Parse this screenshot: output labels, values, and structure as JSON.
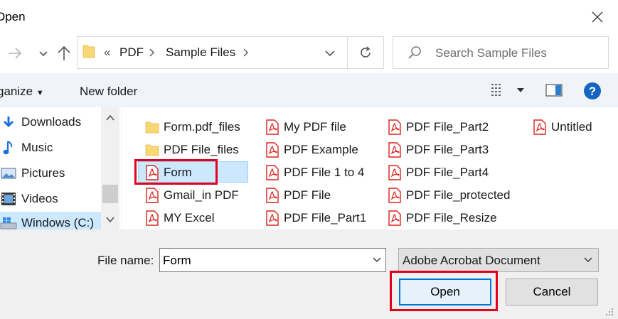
{
  "window": {
    "title": "Open",
    "close_icon": "close-icon"
  },
  "address": {
    "prefix": "«",
    "crumbs": [
      "PDF",
      "Sample Files"
    ],
    "refresh_icon": "refresh-icon"
  },
  "search": {
    "placeholder": "Search Sample Files"
  },
  "commands": {
    "organize": "ganize",
    "new_folder": "New folder"
  },
  "nav": {
    "items": [
      {
        "label": "Downloads",
        "icon": "download-icon"
      },
      {
        "label": "Music",
        "icon": "music-icon"
      },
      {
        "label": "Pictures",
        "icon": "pictures-icon"
      },
      {
        "label": "Videos",
        "icon": "videos-icon"
      },
      {
        "label": "Windows (C:)",
        "icon": "drive-icon"
      }
    ]
  },
  "files": {
    "col1": [
      {
        "name": "Form.pdf_files",
        "type": "folder"
      },
      {
        "name": "PDF File_files",
        "type": "folder"
      },
      {
        "name": "Form",
        "type": "pdf",
        "selected": true
      },
      {
        "name": "Gmail_in PDF",
        "type": "pdf"
      },
      {
        "name": "MY Excel",
        "type": "pdf"
      }
    ],
    "col2": [
      {
        "name": "My PDF file",
        "type": "pdf"
      },
      {
        "name": "PDF Example",
        "type": "pdf"
      },
      {
        "name": "PDF File 1 to 4",
        "type": "pdf"
      },
      {
        "name": "PDF File",
        "type": "pdf"
      },
      {
        "name": "PDF File_Part1",
        "type": "pdf"
      }
    ],
    "col3": [
      {
        "name": "PDF File_Part2",
        "type": "pdf"
      },
      {
        "name": "PDF File_Part3",
        "type": "pdf"
      },
      {
        "name": "PDF File_Part4",
        "type": "pdf"
      },
      {
        "name": "PDF File_protected",
        "type": "pdf"
      },
      {
        "name": "PDF File_Resize",
        "type": "pdf"
      }
    ],
    "col4": [
      {
        "name": "Untitled",
        "type": "pdf"
      }
    ]
  },
  "bottom": {
    "file_name_label": "File name:",
    "file_name_value": "Form",
    "file_type": "Adobe Acrobat Document",
    "open_label": "Open",
    "cancel_label": "Cancel"
  },
  "colors": {
    "accent": "#0078d7",
    "highlight": "#e3001b",
    "selection": "#cce8ff",
    "pdf_red": "#d9231c",
    "folder_yellow": "#f8d775"
  }
}
